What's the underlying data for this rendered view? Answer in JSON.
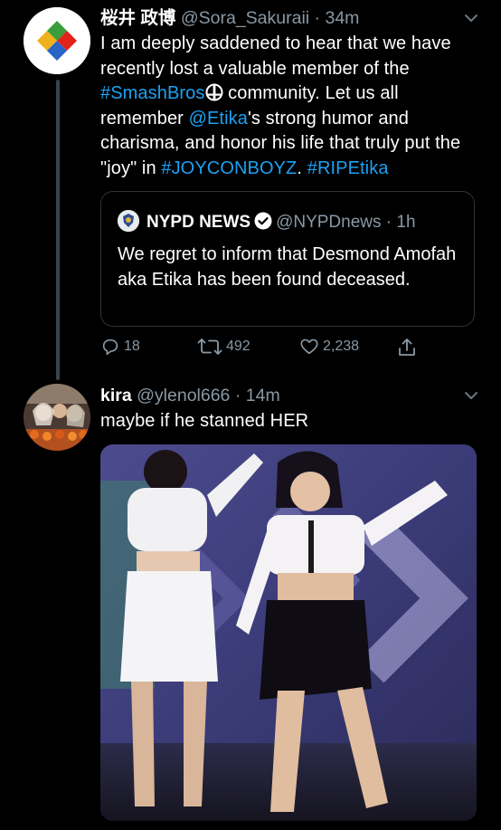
{
  "tweet1": {
    "display_name": "桜井 政博",
    "handle": "@Sora_Sakuraii",
    "separator": " · ",
    "time": "34m",
    "text": {
      "part1": "I am deeply saddened to hear that we have recently lost a valuable member of the ",
      "hashtag_smash": "#SmashBros",
      "part2": " community. Let us all remember ",
      "mention_etika": "@Etika",
      "part3": "'s strong humor and charisma, and honor his life that truly put the \"joy\" in ",
      "hashtag_joycon": "#JOYCONBOYZ",
      "part4": ". ",
      "hashtag_rip": "#RIPEtika"
    },
    "quote": {
      "display_name": "NYPD NEWS",
      "handle": "@NYPDnews",
      "separator": " · ",
      "time": "1h",
      "text": "We regret to inform that Desmond Amofah aka Etika has been found deceased."
    },
    "actions": {
      "replies": "18",
      "retweets": "492",
      "likes": "2,238"
    }
  },
  "tweet2": {
    "display_name": "kira",
    "handle": "@ylenol666",
    "separator": " · ",
    "time": "14m",
    "text": "maybe if he stanned HER"
  },
  "colors": {
    "background": "#000000",
    "link": "#1da1f2",
    "secondary_text": "#8899a6",
    "border": "#2f3336"
  },
  "icons": [
    "chevron-down-icon",
    "smash-logo-icon",
    "verified-badge-icon",
    "reply-icon",
    "retweet-icon",
    "like-icon",
    "share-icon"
  ]
}
